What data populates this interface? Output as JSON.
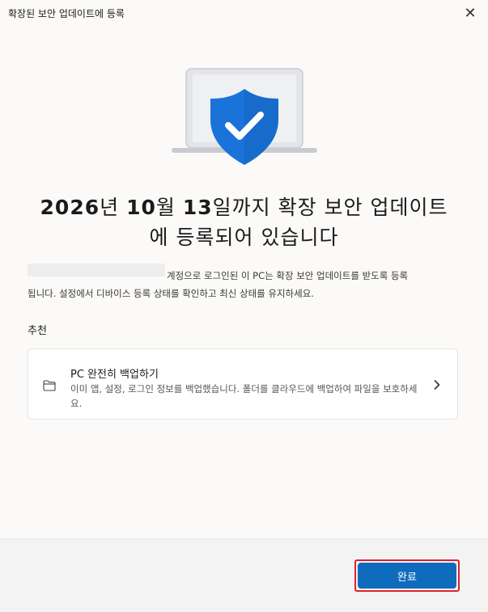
{
  "window": {
    "title": "확장된 보안 업데이트에 등록",
    "close_label": "✕"
  },
  "hero": {
    "icon": "laptop-shield-check-icon",
    "colors": {
      "shield": "#1a73d9",
      "laptop": "#d7d9dd",
      "check": "#ffffff"
    }
  },
  "headline": {
    "date_year": "2026",
    "unit_year": "년 ",
    "date_month": "10",
    "unit_month": "월 ",
    "date_day": "13",
    "rest_line1": "일까지 확장 보안 업데이트",
    "line2": "에 등록되어 있습니다"
  },
  "body": {
    "line1": "계정으로 로그인된 이 PC는 확장 보안 업데이트를 받도록 등록",
    "line2": "됩니다. 설정에서 디바이스 등록 상태를 확인하고 최신 상태를 유지하세요."
  },
  "recommendations": {
    "label": "추천",
    "card": {
      "icon": "folder-icon",
      "title": "PC 완전히 백업하기",
      "description": "이미 앱, 설정, 로그인 정보를 백업했습니다. 폴더를 클라우드에 백업하여 파일을 보호하세요."
    }
  },
  "footer": {
    "done_label": "완료",
    "accent": "#0f6cbd",
    "highlight": "#e0202a"
  }
}
